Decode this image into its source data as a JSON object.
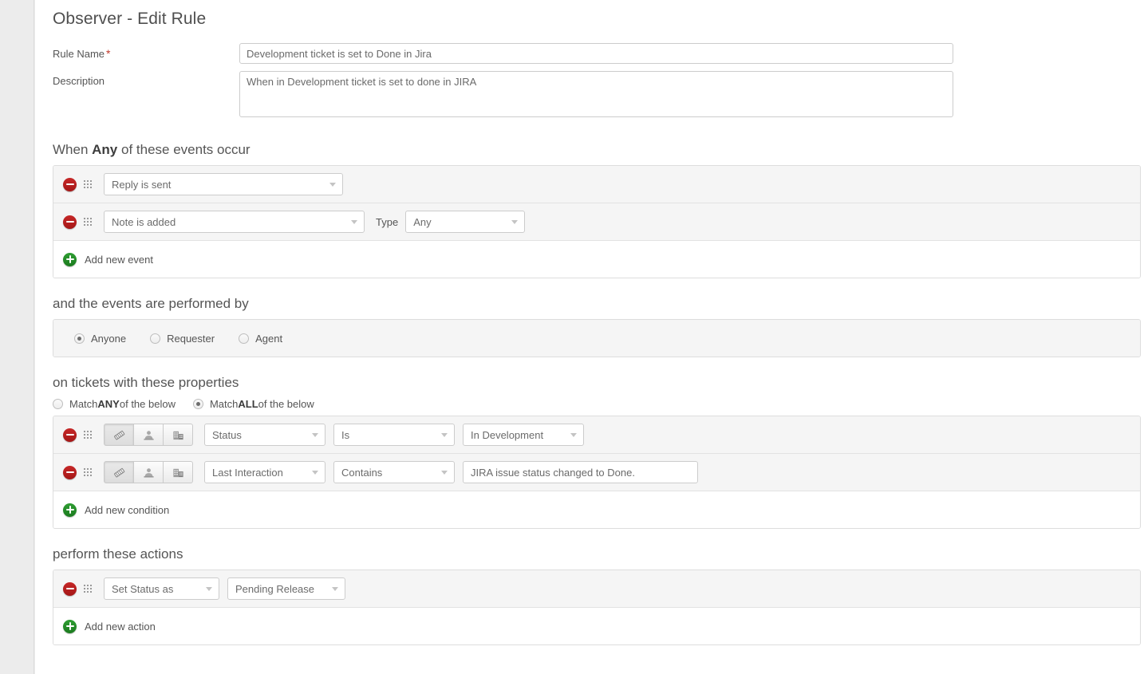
{
  "page": {
    "title": "Observer - Edit Rule"
  },
  "form": {
    "rule_name": {
      "label": "Rule Name",
      "required_marker": "*",
      "value": "Development ticket is set to Done in Jira",
      "placeholder": ""
    },
    "description": {
      "label": "Description",
      "value": "When in Development ticket is set to done in JIRA",
      "placeholder": ""
    }
  },
  "events_section": {
    "heading_prefix": "When ",
    "heading_strong": "Any",
    "heading_suffix": " of these events occur",
    "rows": [
      {
        "event": "Reply is sent",
        "has_type": false,
        "type_label": "",
        "type_value": ""
      },
      {
        "event": "Note is added",
        "has_type": true,
        "type_label": "Type",
        "type_value": "Any"
      }
    ],
    "add_label": "Add new event"
  },
  "performer_section": {
    "heading": "and the events are performed by",
    "options": [
      {
        "label": "Anyone",
        "selected": true
      },
      {
        "label": "Requester",
        "selected": false
      },
      {
        "label": "Agent",
        "selected": false
      }
    ]
  },
  "conditions_section": {
    "heading": "on tickets with these properties",
    "match_options": [
      {
        "prefix": "Match ",
        "strong": "ANY",
        "suffix": " of the below",
        "selected": false
      },
      {
        "prefix": "Match ",
        "strong": "ALL",
        "suffix": " of the below",
        "selected": true
      }
    ],
    "scope_icons": [
      {
        "name": "ticket-icon",
        "active": true
      },
      {
        "name": "contact-icon",
        "active": false
      },
      {
        "name": "company-icon",
        "active": false
      }
    ],
    "rows": [
      {
        "field": "Status",
        "operator": "Is",
        "value_type": "dropdown",
        "value": "In Development"
      },
      {
        "field": "Last Interaction",
        "operator": "Contains",
        "value_type": "text",
        "value": "JIRA issue status changed to Done."
      }
    ],
    "add_label": "Add new condition"
  },
  "actions_section": {
    "heading": "perform these actions",
    "rows": [
      {
        "action": "Set Status as",
        "value": "Pending Release"
      }
    ],
    "add_label": "Add new action"
  },
  "colors": {
    "remove": "#b01b1b",
    "add": "#1f8324",
    "required": "#c0392b",
    "row_bg": "#f5f5f5",
    "panel_border": "#dddddd"
  }
}
